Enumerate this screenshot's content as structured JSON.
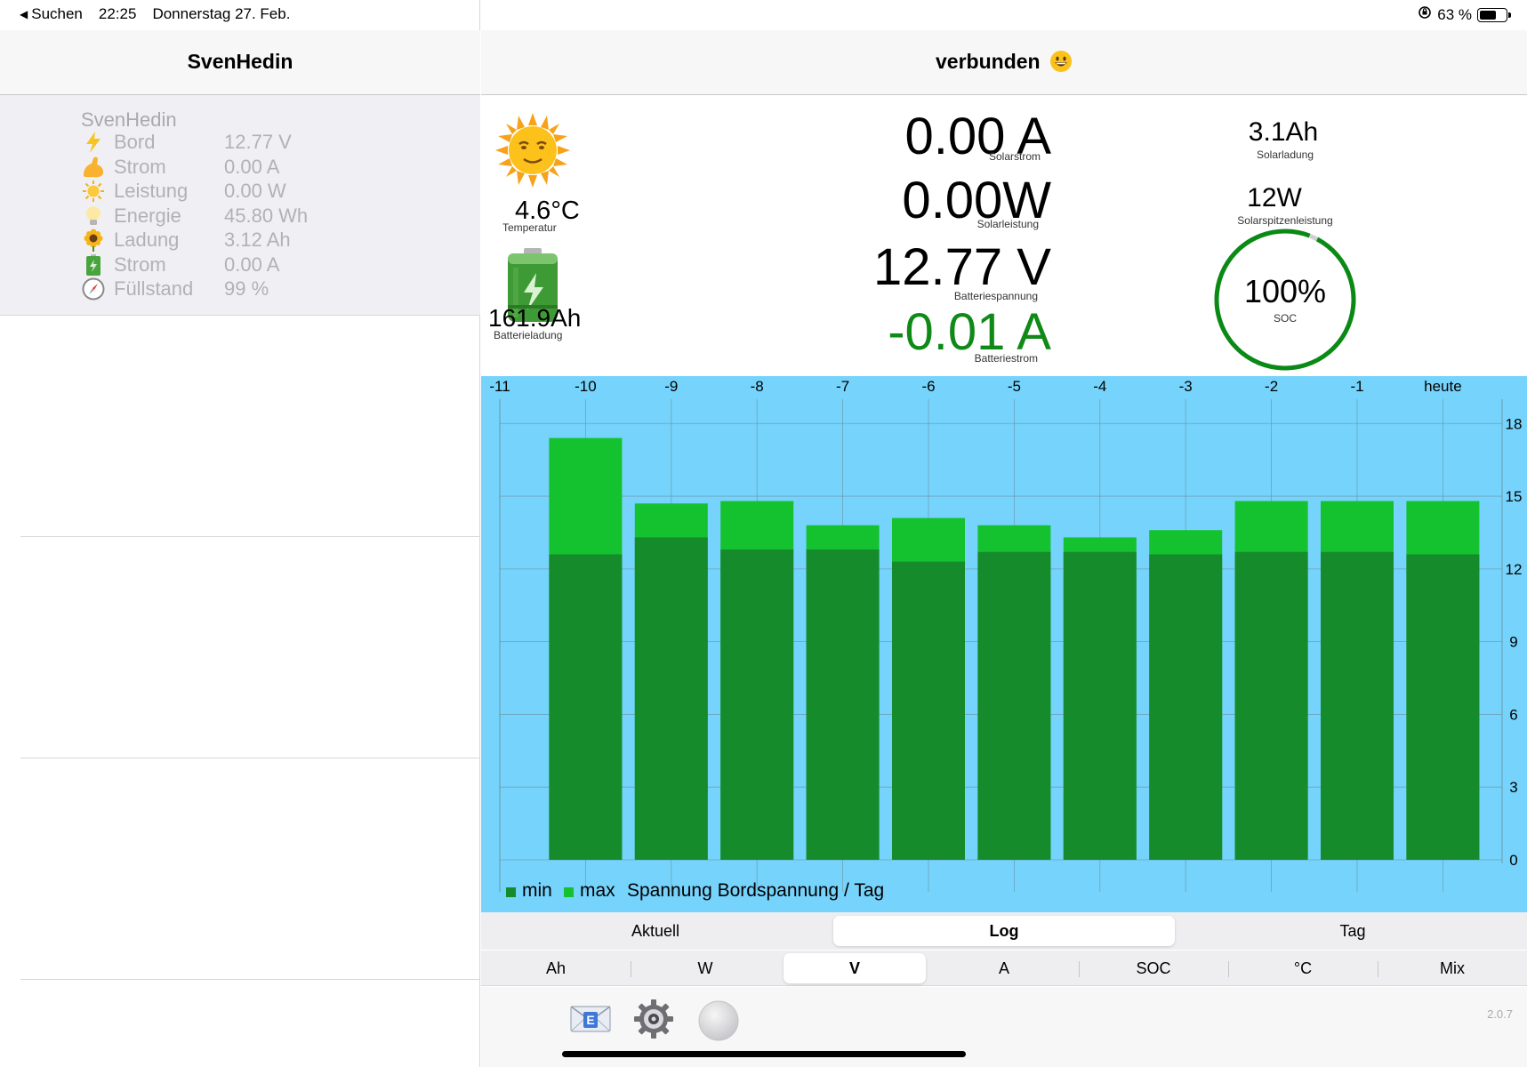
{
  "status": {
    "back_label": "Suchen",
    "time": "22:25",
    "date": "Donnerstag 27. Feb.",
    "battery_text": "63 %",
    "battery_level": 0.63
  },
  "sidebar": {
    "title": "SvenHedin",
    "device": {
      "name": "SvenHedin",
      "rows": [
        {
          "icon": "lightning-icon",
          "label": "Bord",
          "value": "12.77 V"
        },
        {
          "icon": "flexed-biceps-icon",
          "label": "Strom",
          "value": "0.00 A"
        },
        {
          "icon": "sun-icon",
          "label": "Leistung",
          "value": "0.00 W"
        },
        {
          "icon": "lightbulb-icon",
          "label": "Energie",
          "value": "45.80 Wh"
        },
        {
          "icon": "sunflower-icon",
          "label": "Ladung",
          "value": "3.12 Ah"
        },
        {
          "icon": "battery-icon",
          "label": "Strom",
          "value": "0.00 A"
        },
        {
          "icon": "compass-icon",
          "label": "Füllstand",
          "value": " 99 %"
        }
      ]
    }
  },
  "main": {
    "title": "verbunden",
    "title_emoji": "grinning-face-icon",
    "temperature": {
      "value": "4.6°C",
      "caption": "Temperatur"
    },
    "battery_charge": {
      "value": "161.9Ah",
      "caption": "Batterieladung"
    },
    "solar_current": {
      "value": "0.00 A",
      "caption": "Solarstrom"
    },
    "solar_power": {
      "value": "0.00W",
      "caption": "Solarleistung"
    },
    "battery_voltage": {
      "value": "12.77 V",
      "caption": "Batteriespannung"
    },
    "battery_current": {
      "value": "-0.01 A",
      "caption": "Batteriestrom"
    },
    "solar_charge": {
      "value": "3.1Ah",
      "caption": "Solarladung"
    },
    "solar_peak": {
      "value": "12W",
      "caption": "Solarspitzenleistung"
    },
    "soc": {
      "value": "100%",
      "caption": "SOC",
      "fraction": 0.98
    }
  },
  "colors": {
    "chart_background": "#76d3fb",
    "min_bar": "#158b2b",
    "max_bar": "#14c12f",
    "soc_ring": "#0a8a14",
    "negative_current": "#0f8a17"
  },
  "chart_data": {
    "type": "bar",
    "categories": [
      "-11",
      "-10",
      "-9",
      "-8",
      "-7",
      "-6",
      "-5",
      "-4",
      "-3",
      "-2",
      "-1",
      "heute"
    ],
    "series": [
      {
        "name": "min",
        "values": [
          null,
          12.6,
          13.3,
          12.8,
          12.8,
          12.3,
          12.7,
          12.7,
          12.6,
          12.7,
          12.7,
          12.6
        ]
      },
      {
        "name": "max",
        "values": [
          null,
          17.4,
          14.7,
          14.8,
          13.8,
          14.1,
          13.8,
          13.3,
          13.6,
          14.8,
          14.8,
          14.8
        ]
      }
    ],
    "yticks": [
      "18",
      "15",
      "12",
      "9",
      "6",
      "3",
      "0"
    ],
    "ylim": [
      0,
      19
    ],
    "legend": {
      "min": "min",
      "max": "max",
      "text": "Spannung Bordspannung / Tag"
    }
  },
  "tabs_main": [
    {
      "label": "Aktuell",
      "active": false
    },
    {
      "label": "Log",
      "active": true
    },
    {
      "label": "Tag",
      "active": false
    }
  ],
  "tabs_units": [
    {
      "label": "Ah",
      "active": false
    },
    {
      "label": "W",
      "active": false
    },
    {
      "label": "V",
      "active": true
    },
    {
      "label": "A",
      "active": false
    },
    {
      "label": "SOC",
      "active": false
    },
    {
      "label": "°C",
      "active": false
    },
    {
      "label": "Mix",
      "active": false
    }
  ],
  "toolbar": {
    "mail_icon": "email-icon",
    "settings_icon": "gear-icon",
    "status_icon": "status-circle-icon",
    "version": "2.0.7"
  }
}
